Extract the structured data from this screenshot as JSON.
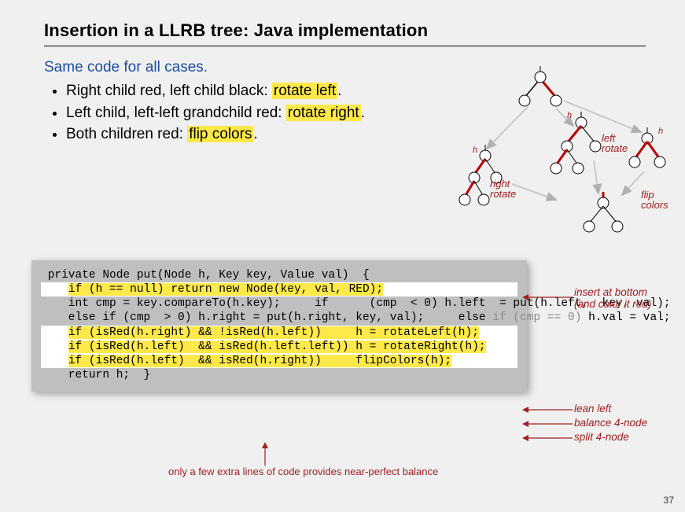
{
  "title": "Insertion in a LLRB tree:  Java implementation",
  "lead": "Same code for all cases.",
  "bullets": [
    {
      "prefix": "Right child red, left child black: ",
      "action": "rotate left",
      "suffix": "."
    },
    {
      "prefix": "Left child, left-left grandchild red: ",
      "action": "rotate right",
      "suffix": "."
    },
    {
      "prefix": "Both children red: ",
      "action": "flip colors",
      "suffix": "."
    }
  ],
  "diagram_labels": {
    "h": "h",
    "right_rotate": "right\nrotate",
    "left_rotate": "left\nrotate",
    "flip_colors": "flip\ncolors"
  },
  "code": {
    "l1": " private Node put(Node h, Key key, Value val)",
    "l2": " {",
    "l3_pre": "    ",
    "l3": "if (h == null) return new Node(key, val, RED);",
    "l4": "    int cmp = key.compareTo(h.key);",
    "l5": "    if      (cmp  < 0) h.left  = put(h.left,  key, val);",
    "l6": "    else if (cmp  > 0) h.right = put(h.right, key, val);",
    "l7a": "    else ",
    "l7b": "if (cmp == 0)",
    "l7c": " h.val = val;",
    "blank": "",
    "l8_pre": "    ",
    "l8": "if (isRed(h.right) && !isRed(h.left))     h = rotateLeft(h);",
    "l9_pre": "    ",
    "l9": "if (isRed(h.left)  && isRed(h.left.left)) h = rotateRight(h);",
    "l10_pre": "    ",
    "l10": "if (isRed(h.left)  && isRed(h.right))     flipColors(h);",
    "l11": "    return h;",
    "l12": " }"
  },
  "annotations": {
    "insert": "insert at bottom\n(and color it red)",
    "lean": "lean left",
    "balance": "balance 4-node",
    "split": "split 4-node",
    "footer": "only a few extra lines of code provides near-perfect balance"
  },
  "page": "37"
}
